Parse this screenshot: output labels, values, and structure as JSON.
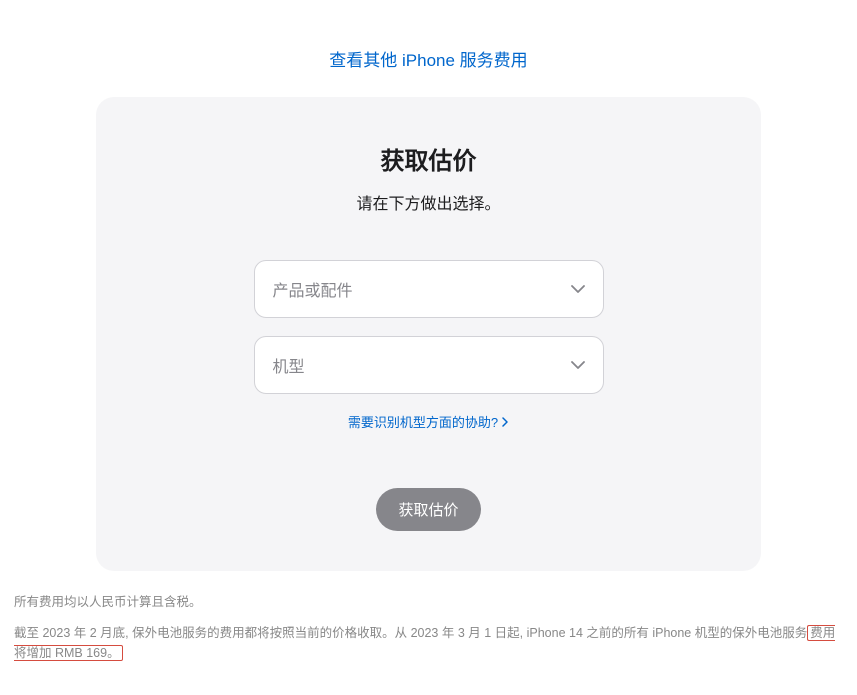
{
  "header": {
    "top_link_label": "查看其他 iPhone 服务费用"
  },
  "card": {
    "title": "获取估价",
    "subtitle": "请在下方做出选择。",
    "select_product_placeholder": "产品或配件",
    "select_model_placeholder": "机型",
    "help_link_label": "需要识别机型方面的协助?",
    "button_label": "获取估价"
  },
  "disclaimer": {
    "line1": "所有费用均以人民币计算且含税。",
    "line2_prefix": "截至 2023 年 2 月底, 保外电池服务的费用都将按照当前的价格收取。从 2023 年 3 月 1 日起, iPhone 14 之前的所有 iPhone 机型的保外电池服务",
    "line2_highlighted": "费用将增加 RMB 169。"
  }
}
